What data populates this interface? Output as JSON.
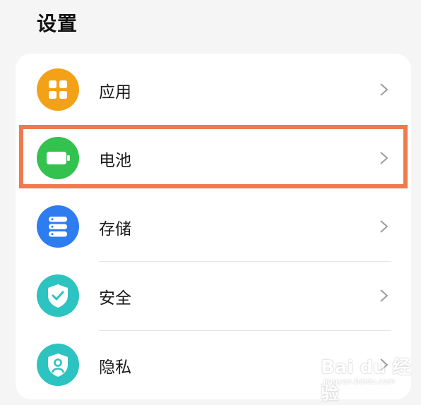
{
  "header": {
    "title": "设置"
  },
  "settings_list": {
    "items": [
      {
        "label": "应用",
        "icon": "apps-grid-icon",
        "icon_color": "#f3a117"
      },
      {
        "label": "电池",
        "icon": "battery-icon",
        "icon_color": "#32c24d"
      },
      {
        "label": "存储",
        "icon": "storage-icon",
        "icon_color": "#2d7df0"
      },
      {
        "label": "安全",
        "icon": "security-shield-icon",
        "icon_color": "#2cc3c0"
      },
      {
        "label": "隐私",
        "icon": "privacy-shield-icon",
        "icon_color": "#2cc3c0"
      }
    ]
  },
  "annotation": {
    "highlight_color": "#ee7a4e"
  },
  "watermark": {
    "logo": "Bai du 经验",
    "url": "jingyan.baidu.com"
  }
}
